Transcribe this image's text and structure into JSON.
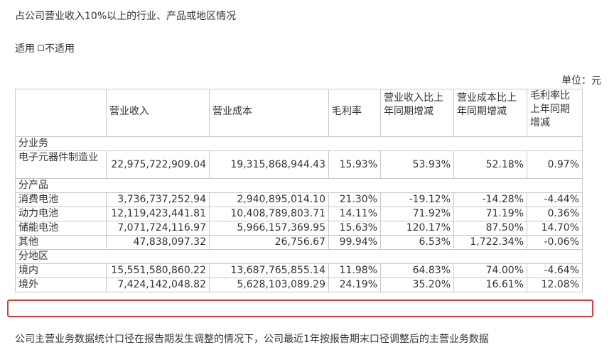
{
  "heading": "占公司营业收入10%以上的行业、产品或地区情况",
  "applicable": {
    "yes": "适用",
    "no": "不适用"
  },
  "unit": "单位：元",
  "table": {
    "headers": [
      "",
      "营业收入",
      "营业成本",
      "毛利率",
      "营业收入比上年同期增减",
      "营业成本比上年同期增减",
      "毛利率比上年同期增减"
    ],
    "sections": [
      {
        "title": "分业务",
        "rows": [
          [
            "电子元器件制造业",
            "22,975,722,909.04",
            "19,315,868,944.43",
            "15.93%",
            "53.93%",
            "52.18%",
            "0.97%"
          ]
        ]
      },
      {
        "title": "分产品",
        "rows": [
          [
            "消费电池",
            "3,736,737,252.94",
            "2,940,895,014.10",
            "21.30%",
            "-19.12%",
            "-14.28%",
            "-4.44%"
          ],
          [
            "动力电池",
            "12,119,423,441.81",
            "10,408,789,803.71",
            "14.11%",
            "71.92%",
            "71.19%",
            "0.36%"
          ],
          [
            "储能电池",
            "7,071,724,116.97",
            "5,966,157,369.95",
            "15.63%",
            "120.17%",
            "87.50%",
            "14.70%"
          ],
          [
            "其他",
            "47,838,097.32",
            "26,756.67",
            "99.94%",
            "6.53%",
            "1,722.34%",
            "-0.06%"
          ]
        ]
      },
      {
        "title": "分地区",
        "rows": [
          [
            "境内",
            "15,551,580,860.22",
            "13,687,765,855.14",
            "11.98%",
            "64.83%",
            "74.00%",
            "-4.64%"
          ],
          [
            "境外",
            "7,424,142,048.82",
            "5,628,103,089.29",
            "24.19%",
            "35.20%",
            "16.61%",
            "12.08%"
          ]
        ]
      }
    ]
  },
  "footnote": "公司主营业务数据统计口径在报告期发生调整的情况下，公司最近1年按报告期末口径调整后的主营业务数据",
  "colors": {
    "highlight": "#e8372e",
    "border": "#c8c8c8",
    "text": "#333333"
  }
}
